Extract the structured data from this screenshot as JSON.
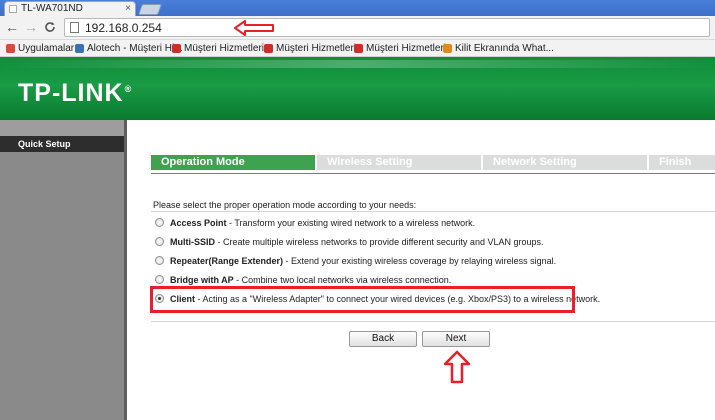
{
  "browser": {
    "tab_title": "TL-WA701ND",
    "tab_close": "×",
    "url": "192.168.0.254",
    "back_glyph": "←",
    "forward_glyph": "→",
    "reload_glyph": "C",
    "bookmarks": [
      {
        "label": "Uygulamalar",
        "icon": "apps-grid-icon",
        "color": "#d64b3a"
      },
      {
        "label": "Alotech - Müşteri Hi...",
        "icon": "alotech-icon",
        "color": "#3b6fb6"
      },
      {
        "label": "Müşteri Hizmetleri",
        "icon": "page-icon",
        "color": "#c9302c"
      },
      {
        "label": "Müşteri Hizmetleri",
        "icon": "page-icon",
        "color": "#c9302c"
      },
      {
        "label": "Müşteri Hizmetleri",
        "icon": "page-icon",
        "color": "#c9302c"
      },
      {
        "label": "Kilit Ekranında What...",
        "icon": "elb-icon",
        "color": "#e08a1e"
      }
    ]
  },
  "header": {
    "logo_text": "TP-LINK",
    "logo_reg": "®",
    "brand_color": "#128f3c"
  },
  "sidebar": {
    "items": [
      {
        "label": "Quick Setup",
        "active": true
      }
    ]
  },
  "wizard": {
    "steps": [
      {
        "label": "Operation Mode",
        "active": true
      },
      {
        "label": "Wireless Setting",
        "active": false
      },
      {
        "label": "Network Setting",
        "active": false
      },
      {
        "label": "Finish",
        "active": false
      }
    ],
    "prompt": "Please select the proper operation mode according to your needs:",
    "options": [
      {
        "name": "Access Point",
        "desc": " - Transform your existing wired network to a wireless network.",
        "checked": false
      },
      {
        "name": "Multi-SSID",
        "desc": " - Create multiple wireless networks to provide different security and VLAN groups.",
        "checked": false
      },
      {
        "name": "Repeater(Range Extender)",
        "desc": " - Extend your existing wireless coverage by relaying wireless signal.",
        "checked": false
      },
      {
        "name": "Bridge with AP",
        "desc": " - Combine two local networks via wireless connection.",
        "checked": false
      },
      {
        "name": "Client",
        "desc": " - Acting as a \"Wireless Adapter\" to connect your wired devices (e.g. Xbox/PS3) to a wireless network.",
        "checked": true
      }
    ],
    "back_label": "Back",
    "next_label": "Next",
    "accent_color": "#3ea24f"
  },
  "annotations": {
    "color": "#e8202a"
  }
}
